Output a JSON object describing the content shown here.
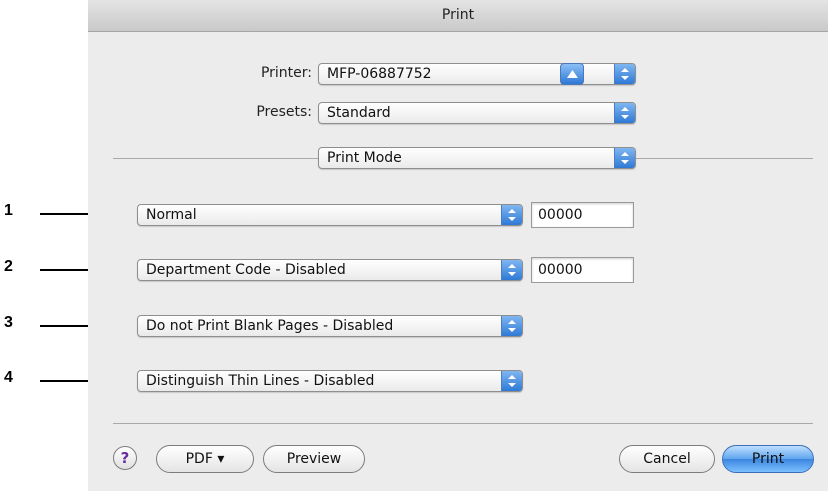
{
  "window": {
    "title": "Print"
  },
  "printer": {
    "label": "Printer:",
    "value": "MFP-06887752"
  },
  "presets": {
    "label": "Presets:",
    "value": "Standard"
  },
  "panel": {
    "value": "Print Mode"
  },
  "rows": [
    {
      "callout": "1",
      "value": "Normal",
      "field": "00000"
    },
    {
      "callout": "2",
      "value": "Department Code - Disabled",
      "field": "00000"
    },
    {
      "callout": "3",
      "value": "Do not Print Blank Pages - Disabled"
    },
    {
      "callout": "4",
      "value": "Distinguish Thin Lines - Disabled"
    }
  ],
  "footer": {
    "help": "?",
    "pdf": "PDF ▾",
    "preview": "Preview",
    "cancel": "Cancel",
    "print": "Print"
  },
  "colors": {
    "accent": "#3b86e0",
    "window_bg": "#ececec"
  },
  "icons": {
    "popup_arrows": "up-down-arrows-icon",
    "disclosure": "triangle-up-icon"
  }
}
